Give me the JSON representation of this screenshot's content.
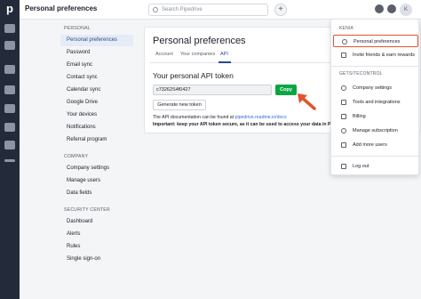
{
  "topbar": {
    "title": "Personal preferences",
    "search_placeholder": "Search Pipedrive",
    "plus": "+",
    "avatar_initial": "K"
  },
  "sidebar": {
    "sections": [
      {
        "title": "PERSONAL",
        "items": [
          "Personal preferences",
          "Password",
          "Email sync",
          "Contact sync",
          "Calendar sync",
          "Google Drive",
          "Your devices",
          "Notifications",
          "Referral program"
        ]
      },
      {
        "title": "COMPANY",
        "items": [
          "Company settings",
          "Manage users",
          "Data fields"
        ]
      },
      {
        "title": "SECURITY CENTER",
        "items": [
          "Dashboard",
          "Alerts",
          "Rules",
          "Single sign-on"
        ]
      }
    ]
  },
  "main": {
    "title": "Personal preferences",
    "tabs": [
      "Account",
      "Your companies",
      "API"
    ],
    "active_tab": "API",
    "api_heading": "Your personal API token",
    "token_value": "c73262S4f0427",
    "copy_label": "Copy",
    "generate_label": "Generate new token",
    "doc_note_prefix": "The API documentation can be found at ",
    "doc_link": "pipedrive.readme.io/docs",
    "important_note": "Important: keep your API token secure, as it can be used to access your data in Pipedr"
  },
  "dropdown": {
    "section1": "KENIA",
    "items1": [
      {
        "label": "Personal preferences",
        "icon": "clock-icon"
      },
      {
        "label": "Invite friends & earn rewards",
        "icon": "gift-icon"
      }
    ],
    "section2": "GETSITECONTROL",
    "items2": [
      {
        "label": "Company settings",
        "icon": "gear-icon"
      },
      {
        "label": "Tools and integrations",
        "icon": "wrench-icon"
      },
      {
        "label": "Billing",
        "icon": "card-icon"
      },
      {
        "label": "Manage subscription",
        "icon": "refresh-icon"
      },
      {
        "label": "Add more users",
        "icon": "user-plus-icon"
      }
    ],
    "logout": "Log out"
  },
  "colors": {
    "accent": "#2c4a8c",
    "copy_green": "#08a742",
    "highlight": "#e2542c",
    "rail": "#232b3a"
  }
}
